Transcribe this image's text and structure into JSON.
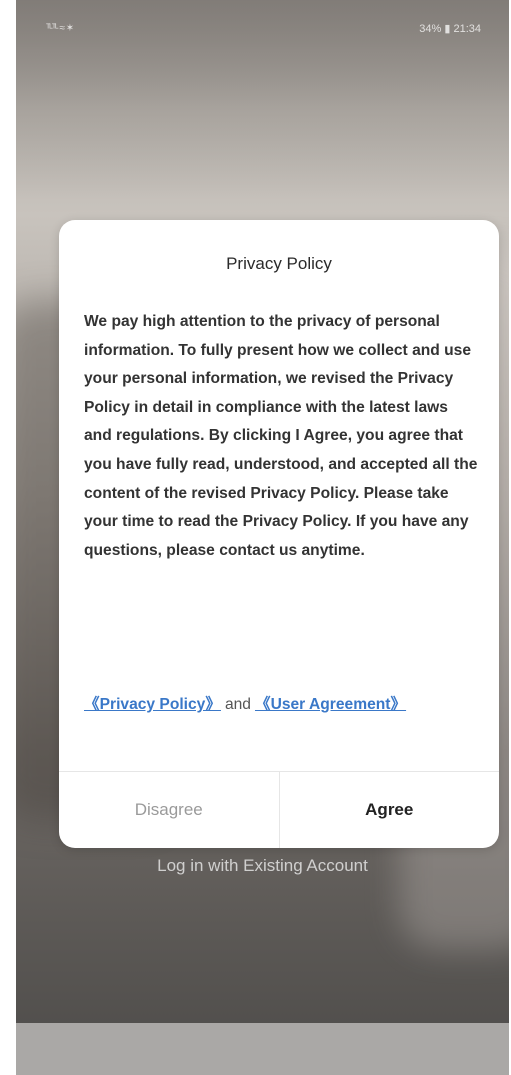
{
  "status_bar": {
    "left_text": "ᵀᴸᵀᴸ ≈ ✶",
    "right_text": "34% ▮ 21:34"
  },
  "dialog": {
    "title": "Privacy Policy",
    "body": "We pay high attention to the privacy of personal information. To fully present how we collect and use your personal information, we revised the Privacy Policy in detail in compliance with the latest laws and regulations. By clicking I Agree, you agree that you have fully read, understood, and accepted all the content of the revised Privacy Policy. Please take your time to read the Privacy Policy. If you have any questions, please contact us anytime.",
    "privacy_link": "《Privacy Policy》",
    "and_text": "and",
    "agreement_link": "《User Agreement》",
    "disagree_label": "Disagree",
    "agree_label": "Agree"
  },
  "login_link": "Log in with Existing Account",
  "colors": {
    "link": "#3a78c8",
    "dialog_bg": "#ffffff",
    "disagree_text": "#9a9a9a"
  }
}
